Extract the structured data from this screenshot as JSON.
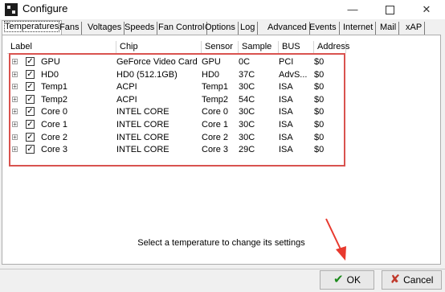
{
  "window": {
    "title": "Configure",
    "minimize": "—",
    "close": "✕"
  },
  "tabs": [
    "Temperatures",
    "Fans",
    "Voltages",
    "Speeds",
    "Fan Control",
    "Options",
    "Log",
    "Advanced",
    "Events",
    "Internet",
    "Mail",
    "xAP"
  ],
  "columns": [
    "Label",
    "Chip",
    "Sensor",
    "Sample",
    "BUS",
    "Address"
  ],
  "rows": [
    {
      "label": "GPU",
      "chip": "GeForce Video Card",
      "sensor": "GPU",
      "sample": "0C",
      "bus": "PCI",
      "address": "$0"
    },
    {
      "label": "HD0",
      "chip": "HD0 (512.1GB)",
      "sensor": "HD0",
      "sample": "37C",
      "bus": "AdvS...",
      "address": "$0"
    },
    {
      "label": "Temp1",
      "chip": "ACPI",
      "sensor": "Temp1",
      "sample": "30C",
      "bus": "ISA",
      "address": "$0"
    },
    {
      "label": "Temp2",
      "chip": "ACPI",
      "sensor": "Temp2",
      "sample": "54C",
      "bus": "ISA",
      "address": "$0"
    },
    {
      "label": "Core 0",
      "chip": "INTEL CORE",
      "sensor": "Core 0",
      "sample": "30C",
      "bus": "ISA",
      "address": "$0"
    },
    {
      "label": "Core 1",
      "chip": "INTEL CORE",
      "sensor": "Core 1",
      "sample": "30C",
      "bus": "ISA",
      "address": "$0"
    },
    {
      "label": "Core 2",
      "chip": "INTEL CORE",
      "sensor": "Core 2",
      "sample": "30C",
      "bus": "ISA",
      "address": "$0"
    },
    {
      "label": "Core 3",
      "chip": "INTEL CORE",
      "sensor": "Core 3",
      "sample": "29C",
      "bus": "ISA",
      "address": "$0"
    }
  ],
  "row_state": {
    "expander": "+",
    "check": "✓"
  },
  "status_text": "Select a temperature to change its settings",
  "buttons": {
    "ok": "OK",
    "cancel": "Cancel",
    "ok_icon": "✔",
    "cancel_icon": "✘"
  },
  "colors": {
    "highlight": "#d9534f",
    "arrow": "#e8392e",
    "ok_check": "#1c8a1c",
    "cancel_x": "#c0392b"
  }
}
